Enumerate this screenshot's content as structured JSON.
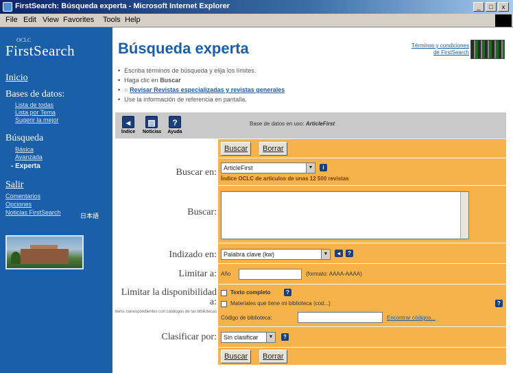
{
  "window": {
    "title": "FirstSearch: Búsqueda experta - Microsoft Internet Explorer",
    "controls": [
      "_",
      "□",
      "x"
    ]
  },
  "menu": [
    "File",
    "Edit",
    "View",
    "Favorites",
    "Tools",
    "Help"
  ],
  "sidebar": {
    "brand_top": "OCLC",
    "brand": "FirstSearch",
    "inicio": "Inicio",
    "bases_title": "Bases de datos:",
    "bases_items": [
      "Lista de todas",
      "Lista por Tema",
      "Sugerir la mejor"
    ],
    "busqueda_title": "Búsqueda",
    "busqueda_items": [
      "Básica",
      "Avanzada"
    ],
    "busqueda_current": "- Experta",
    "salir": "Salir",
    "salir_items": [
      "Comentarios",
      "Opciones",
      "Noticias FirstSearch"
    ],
    "translit": "日本語",
    "library_image": "library-building-photo"
  },
  "main": {
    "title": "Búsqueda experta",
    "corner_link": [
      "Términos y condiciones",
      "de FirstSearch"
    ],
    "instructions": [
      {
        "pre": "Escriba términos de búsqueda y elija los límites.",
        "link": ""
      },
      {
        "pre": "Haga clic en ",
        "bold": "Buscar",
        "link": ""
      },
      {
        "pre": "○ ",
        "link": "Revisar Revistas especializadas y revistas generales"
      },
      {
        "pre": "Use la información de referencia en pantalla.",
        "link": ""
      }
    ],
    "toolbar": [
      {
        "label": "Índice",
        "icon": "index-icon"
      },
      {
        "label": "Noticias",
        "icon": "news-icon"
      },
      {
        "label": "Ayuda",
        "icon": "help-icon"
      }
    ],
    "db_prefix": "Base de datos en uso: ",
    "db_name": "ArticleFirst"
  },
  "form": {
    "search_btn": "Buscar",
    "clear_btn": "Borrar",
    "buscar_en_label": "Buscar en:",
    "buscar_en_value": "ArticleFirst",
    "buscar_en_note": "Índice OCLC de artículos de unas 12 500 revistas",
    "buscar_label": "Buscar:",
    "indizado_label": "Indizado en:",
    "indizado_value": "Palabra clave (kw)",
    "limitar_label": "Limitar a:",
    "limitar_ano": "Año",
    "limitar_format": "(formato: AAAA-AAAA)",
    "disp_label": "Limitar la disponibilidad a:",
    "disp_foot": "Items correspondientes con catálogos de las bibliotecas",
    "disp_opt1": "Texto completo",
    "disp_opt2": "Materiales que tiene mi biblioteca (cod...)",
    "lib_code_label": "Código de biblioteca:",
    "lib_code_link": "Encontrar códigos...",
    "clasificar_label": "Clasificar por:",
    "clasificar_value": "Sin clasificar"
  },
  "colors": {
    "sidebar": "#1a5fa8",
    "form": "#f6b34a",
    "toolbar": "#c9c9c9",
    "title": "#1a5fa8"
  }
}
